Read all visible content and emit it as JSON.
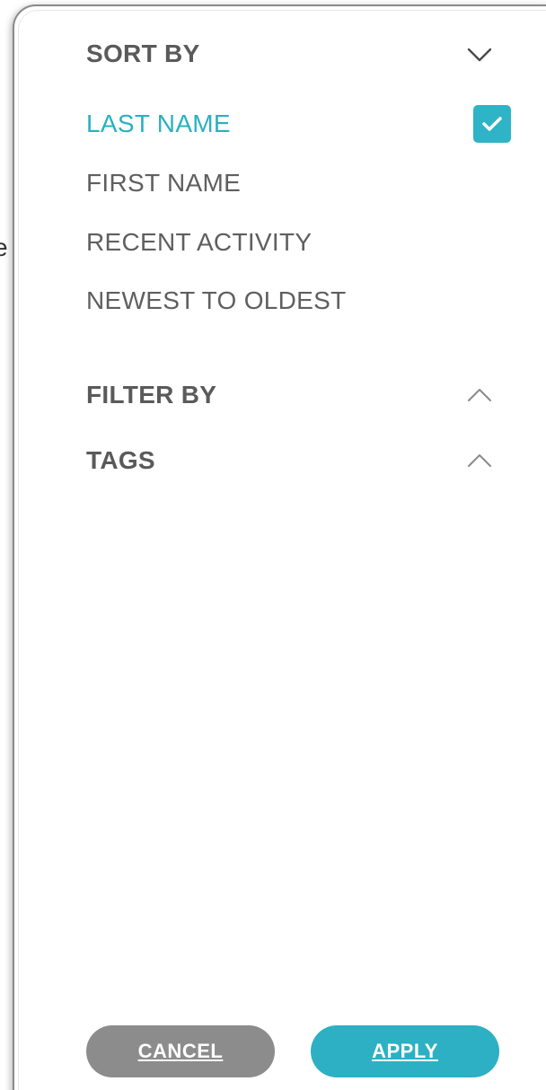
{
  "edge_glyph": "e",
  "sort": {
    "title": "SORT BY",
    "expanded": true,
    "toggle_icon": "chevron-down-icon",
    "options": [
      {
        "label": "LAST NAME",
        "selected": true
      },
      {
        "label": "FIRST NAME",
        "selected": false
      },
      {
        "label": "RECENT ACTIVITY",
        "selected": false
      },
      {
        "label": "NEWEST TO OLDEST",
        "selected": false
      }
    ],
    "selected_icon": "checkmark-icon"
  },
  "filter": {
    "title": "FILTER BY",
    "toggle_icon": "chevron-up-icon"
  },
  "tags": {
    "title": "TAGS",
    "toggle_icon": "chevron-up-icon"
  },
  "buttons": {
    "cancel_label": "CANCEL",
    "apply_label": "APPLY"
  },
  "colors": {
    "accent": "#2db0c3",
    "cancel_button": "#8c8c8c",
    "text": "#5f5f5f"
  }
}
